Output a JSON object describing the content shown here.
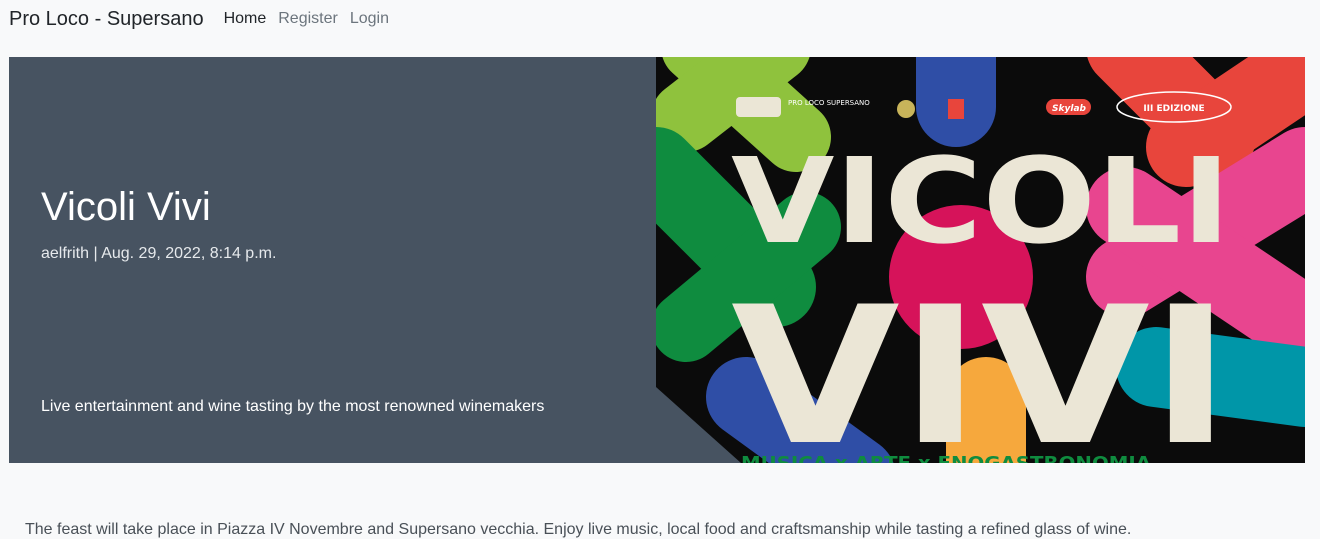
{
  "navbar": {
    "brand": "Pro Loco - Supersano",
    "links": [
      "Home",
      "Register",
      "Login"
    ]
  },
  "post": {
    "title": "Vicoli Vivi",
    "meta": "aelfrith | Aug. 29, 2022, 8:14 p.m.",
    "summary": "Live entertainment and wine tasting by the most renowned winemakers",
    "body": "The feast will take place in Piazza IV Novembre and Supersano vecchia. Enjoy live music, local food and craftsmanship while tasting a refined glass of wine."
  },
  "poster": {
    "word1": "VICOLI",
    "word2": "VIVI",
    "edition": "III EDIZIONE",
    "logo_text": "PRO LOCO SUPERSANO",
    "media_partner": "Skylab",
    "footer_text": "MUSICA x ARTE x ENOGASTRONOMIA",
    "colors": {
      "background": "#0b0b0b",
      "letters": "#ebe6d6",
      "green": "#8fc23d",
      "blue": "#2f4ea6",
      "red": "#e8453c",
      "pink": "#e8458f",
      "magenta": "#d6135a",
      "teal": "#0096a8",
      "orange": "#f6a83d",
      "darkgreen": "#0f8c3f"
    }
  }
}
